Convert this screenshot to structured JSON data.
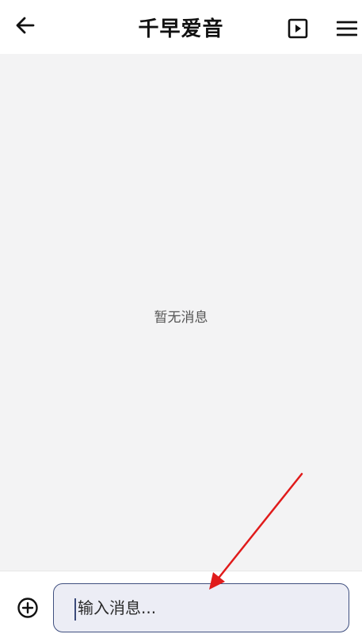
{
  "header": {
    "title": "千早爱音",
    "back_icon": "arrow-left-icon",
    "play_icon": "play-square-icon",
    "menu_icon": "hamburger-menu-icon"
  },
  "chat": {
    "empty_text": "暂无消息"
  },
  "composer": {
    "add_icon": "plus-circle-icon",
    "placeholder": "输入消息..."
  },
  "colors": {
    "chat_background": "#f3f3f4",
    "input_border": "#3f4f7f",
    "input_background": "#ecedf5",
    "annotation_arrow": "#e01b1b"
  }
}
